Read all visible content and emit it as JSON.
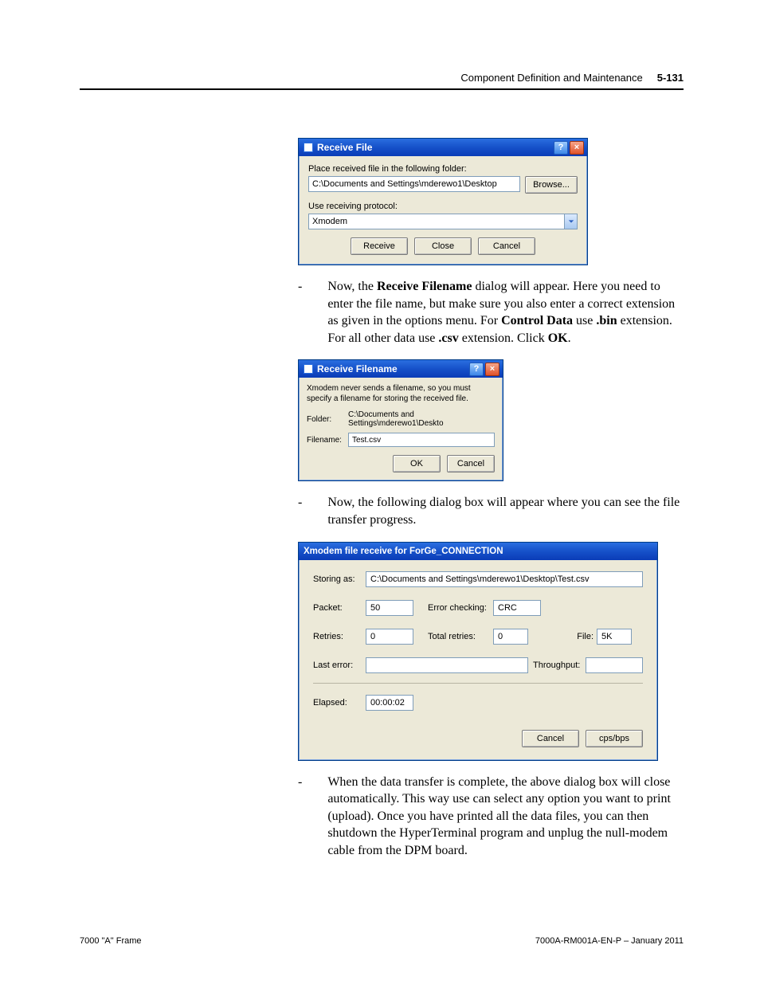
{
  "header": {
    "section": "Component Definition and Maintenance",
    "page": "5-131"
  },
  "dialog_receive_file": {
    "title": "Receive File",
    "help_glyph": "?",
    "close_glyph": "×",
    "lbl_folder": "Place received file in the following folder:",
    "folder_value": "C:\\Documents and Settings\\mderewo1\\Desktop",
    "browse": "Browse...",
    "lbl_protocol": "Use receiving protocol:",
    "protocol_value": "Xmodem",
    "btn_receive": "Receive",
    "btn_close": "Close",
    "btn_cancel": "Cancel"
  },
  "para1": {
    "t1": "Now, the ",
    "b1": "Receive Filename",
    "t2": " dialog will appear. Here you need to enter the file name, but make sure you also enter a correct extension as given in the options menu. For ",
    "b2": "Control Data",
    "t3": " use ",
    "b3": ".bin",
    "t4": " extension. For all other data use ",
    "b4": ".csv",
    "t5": " extension. Click ",
    "b5": "OK",
    "t6": "."
  },
  "dialog_receive_filename": {
    "title": "Receive Filename",
    "help_glyph": "?",
    "close_glyph": "×",
    "info": "Xmodem never sends a filename, so you must specify a filename for storing the received file.",
    "lbl_folder": "Folder:",
    "folder_value": "C:\\Documents and Settings\\mderewo1\\Deskto",
    "lbl_filename": "Filename:",
    "filename_value": "Test.csv",
    "btn_ok": "OK",
    "btn_cancel": "Cancel"
  },
  "para2": "Now, the following dialog box will appear where you can see the file transfer progress.",
  "dialog_progress": {
    "title": "Xmodem file receive for ForGe_CONNECTION",
    "lbl_storing": "Storing as:",
    "storing_value": "C:\\Documents and Settings\\mderewo1\\Desktop\\Test.csv",
    "lbl_packet": "Packet:",
    "packet_value": "50",
    "lbl_errchk": "Error checking:",
    "errchk_value": "CRC",
    "lbl_retries": "Retries:",
    "retries_value": "0",
    "lbl_totretries": "Total retries:",
    "totretries_value": "0",
    "lbl_file": "File:",
    "file_value": "5K",
    "lbl_lasterr": "Last error:",
    "lasterr_value": "",
    "lbl_throughput": "Throughput:",
    "throughput_value": "",
    "lbl_elapsed": "Elapsed:",
    "elapsed_value": "00:00:02",
    "btn_cancel": "Cancel",
    "btn_cps": "cps/bps"
  },
  "para3": "When the data transfer is complete, the above dialog box will close automatically. This way use can select any option you want to print (upload). Once you have printed all the data files, you can then shutdown the HyperTerminal program and unplug the null-modem cable from the DPM board.",
  "footer": {
    "left": "7000 \"A\" Frame",
    "right": "7000A-RM001A-EN-P – January 2011"
  }
}
